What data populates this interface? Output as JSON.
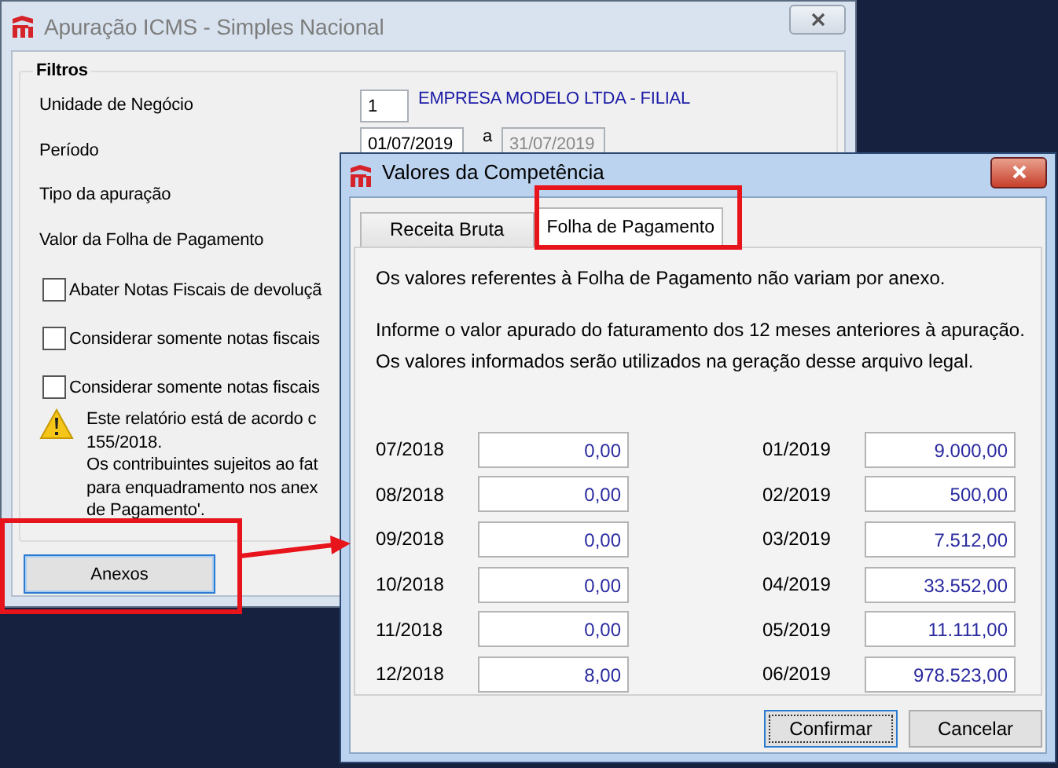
{
  "main_window": {
    "title": "Apuração ICMS - Simples Nacional",
    "filters": {
      "title": "Filtros",
      "fields": [
        {
          "kind": "business",
          "label": "Unidade de Negócio",
          "code": "1",
          "name": "EMPRESA MODELO LTDA - FILIAL"
        },
        {
          "kind": "period",
          "label": "Período",
          "from": "01/07/2019",
          "separator": "a",
          "to": "31/07/2019",
          "to_disabled": true
        },
        {
          "kind": "plain",
          "label": "Tipo da apuração"
        },
        {
          "kind": "plain",
          "label": "Valor da Folha de Pagamento"
        }
      ],
      "checkboxes": [
        {
          "label": "Abater Notas Fiscais de devoluçã",
          "checked": false
        },
        {
          "label": "Considerar somente notas fiscais",
          "checked": false
        },
        {
          "label": "Considerar somente notas fiscais",
          "checked": false
        }
      ],
      "warning": [
        "Este relatório está de acordo c",
        "155/2018.",
        "Os contribuintes sujeitos ao fat",
        "para enquadramento nos anex",
        "de Pagamento'."
      ]
    },
    "button": "Anexos"
  },
  "dialog": {
    "title": "Valores da Competência",
    "tabs": [
      {
        "label": "Receita Bruta",
        "selected": false
      },
      {
        "label": "Folha de Pagamento",
        "selected": true
      }
    ],
    "intro": "Os valores referentes à Folha de Pagamento não variam por anexo.",
    "info": [
      "Informe o valor apurado do faturamento dos 12 meses anteriores à apuração.",
      "Os valores informados serão utilizados na geração desse arquivo legal."
    ],
    "columns": [
      [
        {
          "period": "07/2018",
          "value": "0,00"
        },
        {
          "period": "08/2018",
          "value": "0,00"
        },
        {
          "period": "09/2018",
          "value": "0,00"
        },
        {
          "period": "10/2018",
          "value": "0,00"
        },
        {
          "period": "11/2018",
          "value": "0,00"
        },
        {
          "period": "12/2018",
          "value": "8,00"
        }
      ],
      [
        {
          "period": "01/2019",
          "value": "9.000,00"
        },
        {
          "period": "02/2019",
          "value": "500,00"
        },
        {
          "period": "03/2019",
          "value": "7.512,00"
        },
        {
          "period": "04/2019",
          "value": "33.552,00"
        },
        {
          "period": "05/2019",
          "value": "11.111,00"
        },
        {
          "period": "06/2019",
          "value": "978.523,00"
        }
      ]
    ],
    "buttons": [
      {
        "label": "Confirmar",
        "default": true
      },
      {
        "label": "Cancelar",
        "default": false
      }
    ]
  }
}
